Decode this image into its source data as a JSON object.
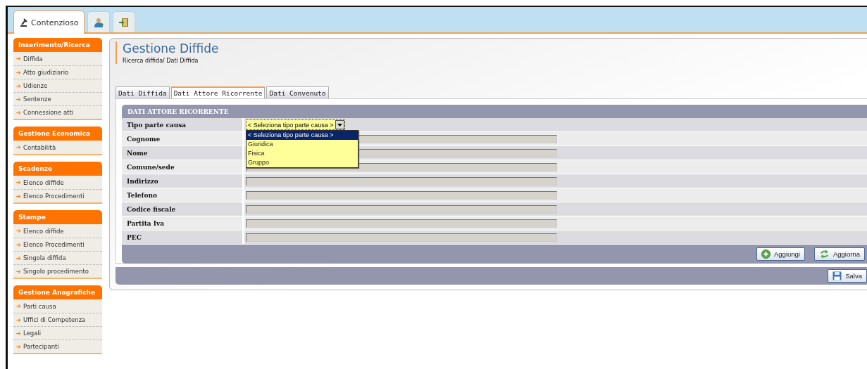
{
  "app_tabs": [
    {
      "kind": "text",
      "label": "Contenzioso",
      "selected": true
    },
    {
      "kind": "people",
      "selected": false
    },
    {
      "kind": "exit",
      "selected": false
    }
  ],
  "sidebar": {
    "sections": [
      {
        "title": "Inserimento/Ricerca",
        "items": [
          "Diffida",
          "Atto giudiziario",
          "Udienze",
          "Sentenze",
          "Connessione atti"
        ]
      },
      {
        "title": "Gestione Economica",
        "items": [
          "Contabilità"
        ]
      },
      {
        "title": "Scadenze",
        "items": [
          "Elenco diffide",
          "Elenco Procedimenti"
        ]
      },
      {
        "title": "Stampe",
        "items": [
          "Elenco diffide",
          "Elenco Procedimenti",
          "Singola diffida",
          "Singolo procedimento"
        ]
      },
      {
        "title": "Gestione Anagrafiche",
        "items": [
          "Parti causa",
          "Uffici di Competenza",
          "Legali",
          "Partecipanti"
        ]
      }
    ]
  },
  "page": {
    "title": "Gestione Diffide",
    "breadcrumb": "Ricerca diffida/ Dati Diffida"
  },
  "tabs": [
    {
      "label": "Dati Diffida",
      "selected": false
    },
    {
      "label": "Dati Attore Ricorrente",
      "selected": true
    },
    {
      "label": "Dati Convenuto",
      "selected": false
    }
  ],
  "form": {
    "title": "DATI ATTORE RICORRENTE",
    "fields": [
      {
        "kind": "select",
        "label": "Tipo parte causa",
        "value": "< Seleziona tipo parte causa >",
        "open": true,
        "options": [
          {
            "label": "< Seleziona tipo parte causa >",
            "selected": true
          },
          {
            "label": "Giuridica",
            "selected": false
          },
          {
            "label": "Fisica",
            "selected": false
          },
          {
            "label": "Gruppo",
            "selected": false
          }
        ]
      },
      {
        "kind": "text",
        "label": "Cognome",
        "disabled": true
      },
      {
        "kind": "text",
        "label": "Nome",
        "disabled": true
      },
      {
        "kind": "text",
        "label": "Comune/sede",
        "disabled": true
      },
      {
        "kind": "text",
        "label": "Indirizzo",
        "disabled": true
      },
      {
        "kind": "text",
        "label": "Telefono",
        "disabled": true
      },
      {
        "kind": "text",
        "label": "Codice fiscale",
        "disabled": true
      },
      {
        "kind": "text",
        "label": "Partita Iva",
        "disabled": true
      },
      {
        "kind": "text",
        "label": "PEC",
        "disabled": true
      }
    ],
    "buttons": [
      {
        "kind": "add",
        "label": "Aggiungi"
      },
      {
        "kind": "refresh",
        "label": "Aggiorna"
      }
    ]
  },
  "footer_buttons": [
    {
      "kind": "save",
      "label": "Salva"
    }
  ]
}
